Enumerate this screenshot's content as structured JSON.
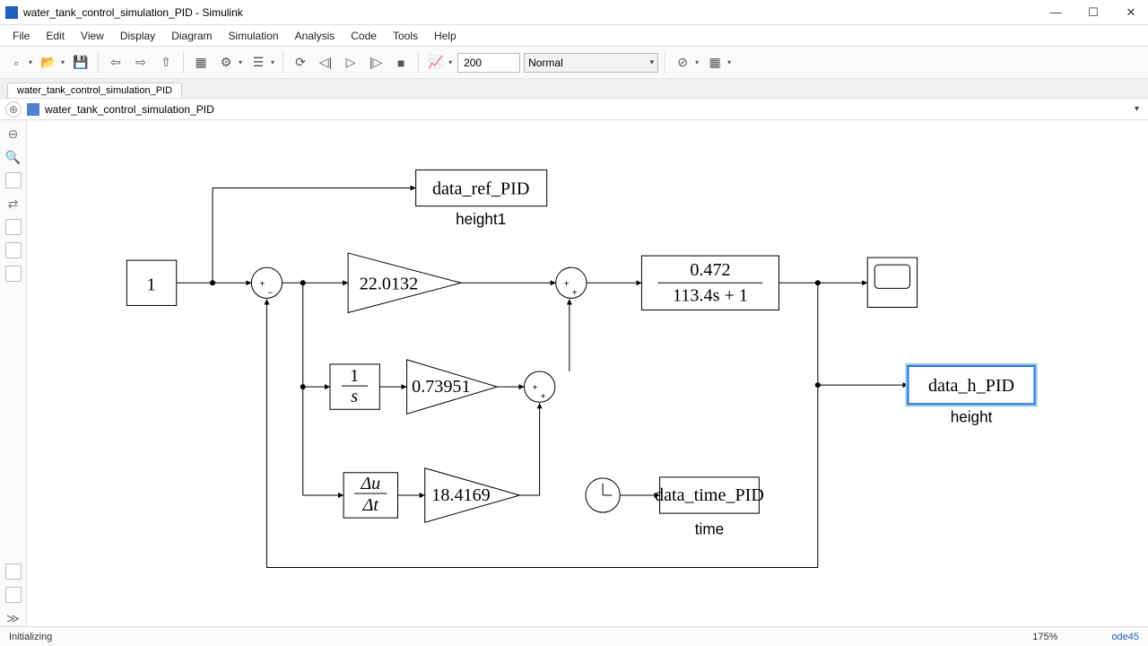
{
  "window": {
    "title": "water_tank_control_simulation_PID - Simulink"
  },
  "menu": {
    "file": "File",
    "edit": "Edit",
    "view": "View",
    "display": "Display",
    "diagram": "Diagram",
    "simulation": "Simulation",
    "analysis": "Analysis",
    "code": "Code",
    "tools": "Tools",
    "help": "Help"
  },
  "toolbar": {
    "stop_time": "200",
    "mode": "Normal"
  },
  "tab": {
    "name": "water_tank_control_simulation_PID"
  },
  "path": {
    "current": "water_tank_control_simulation_PID"
  },
  "blocks": {
    "constant": {
      "value": "1"
    },
    "gain_p": {
      "value": "22.0132"
    },
    "integrator": {
      "num": "1",
      "den": "s"
    },
    "gain_i": {
      "value": "0.73951"
    },
    "derivative": {
      "num": "Δu",
      "den": "Δt"
    },
    "gain_d": {
      "value": "18.4169"
    },
    "transfer_fn": {
      "numerator": "0.472",
      "denominator": "113.4s + 1"
    },
    "to_ws_ref": {
      "varname": "data_ref_PID",
      "label": "height1"
    },
    "to_ws_h": {
      "varname": "data_h_PID",
      "label": "height"
    },
    "to_ws_time": {
      "varname": "data_time_PID",
      "label": "time"
    }
  },
  "status": {
    "left": "Initializing",
    "zoom": "175%",
    "solver": "ode45"
  }
}
